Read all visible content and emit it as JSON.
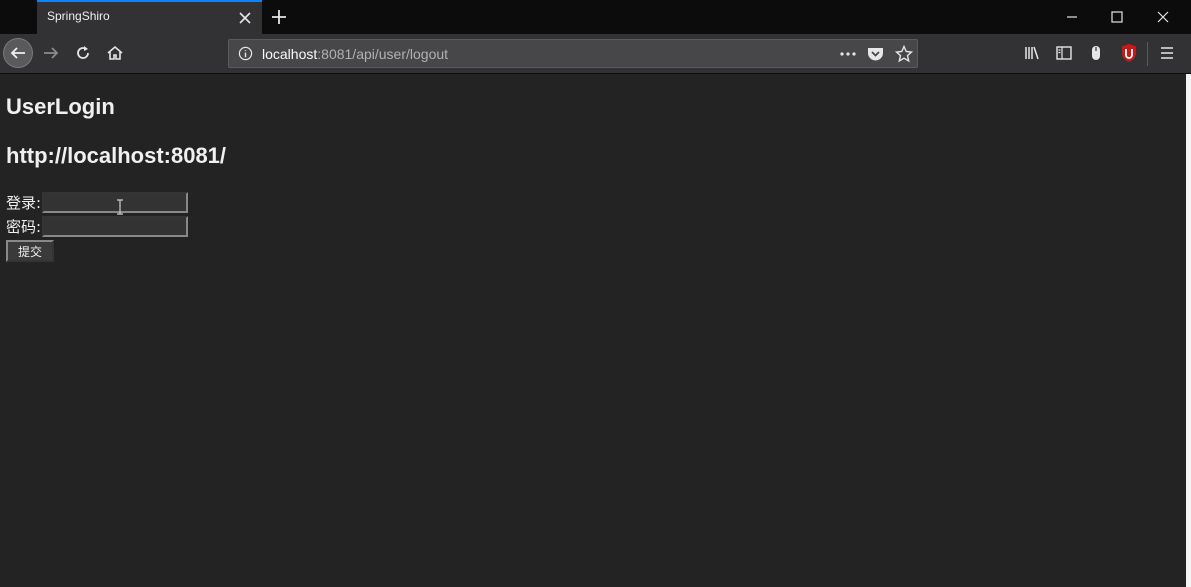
{
  "browser": {
    "tab_title": "SpringShiro",
    "url_host": "localhost",
    "url_rest": ":8081/api/user/logout",
    "accent_color": "#0a84ff"
  },
  "page": {
    "heading": "UserLogin",
    "subheading": "http://localhost:8081/",
    "login_label": "登录:",
    "login_value": "",
    "password_label": "密码:",
    "password_value": "",
    "submit_label": "提交"
  },
  "icons": [
    "close-icon",
    "plus-icon",
    "minimize-icon",
    "maximize-icon",
    "window-close-icon",
    "back-arrow-icon",
    "forward-arrow-icon",
    "reload-icon",
    "home-icon",
    "info-icon",
    "more-icon",
    "pocket-icon",
    "star-icon",
    "library-icon",
    "sidebar-icon",
    "mouse-icon",
    "ublock-icon",
    "menu-icon"
  ]
}
